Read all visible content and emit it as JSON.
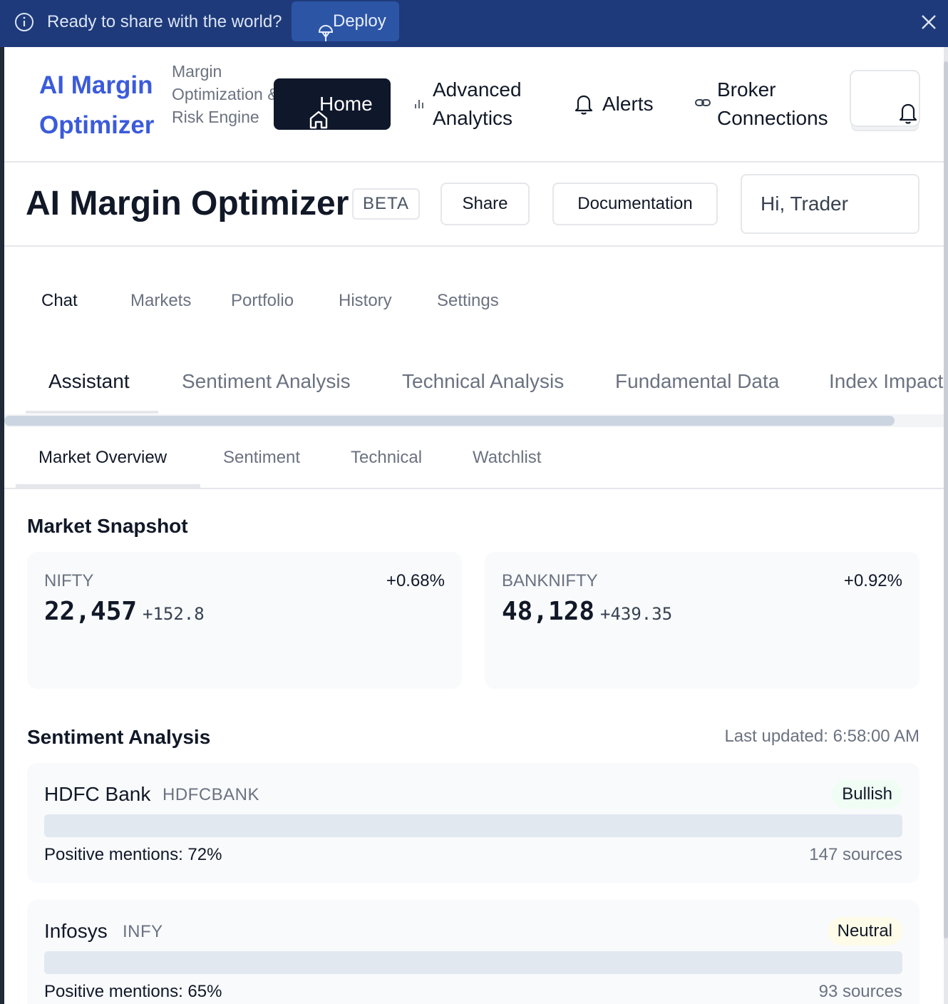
{
  "banner": {
    "message": "Ready to share with the world?",
    "deploy_label": "Deploy"
  },
  "header": {
    "logo_title": "AI Margin Optimizer",
    "logo_subtitle": "Margin Optimization & Risk Engine",
    "nav": {
      "home": "Home",
      "analytics": "Advanced Analytics",
      "alerts": "Alerts",
      "broker": "Broker Connections"
    }
  },
  "title_row": {
    "title": "AI Margin Optimizer",
    "badge": "BETA",
    "share": "Share",
    "docs": "Documentation",
    "greeting": "Hi, Trader"
  },
  "primary_tabs": [
    "Chat",
    "Markets",
    "Portfolio",
    "History",
    "Settings"
  ],
  "secondary_tabs": [
    "Assistant",
    "Sentiment Analysis",
    "Technical Analysis",
    "Fundamental Data",
    "Index Impact"
  ],
  "tertiary_tabs": [
    "Market Overview",
    "Sentiment",
    "Technical",
    "Watchlist"
  ],
  "market_snapshot": {
    "title": "Market Snapshot",
    "indices": [
      {
        "name": "NIFTY",
        "value": "22,457",
        "change": "+152.8",
        "pct": "+0.68%"
      },
      {
        "name": "BANKNIFTY",
        "value": "48,128",
        "change": "+439.35",
        "pct": "+0.92%"
      }
    ]
  },
  "sentiment": {
    "title": "Sentiment Analysis",
    "last_updated": "Last updated: 6:58:00 AM",
    "stocks": [
      {
        "name": "HDFC Bank",
        "symbol": "HDFCBANK",
        "label": "Bullish",
        "positive_pct": 72,
        "mentions": "Positive mentions: 72%",
        "sources": "147 sources"
      },
      {
        "name": "Infosys",
        "symbol": "INFY",
        "label": "Neutral",
        "positive_pct": 65,
        "mentions": "Positive mentions: 65%",
        "sources": "93 sources"
      }
    ]
  },
  "colors": {
    "banner_bg": "#1e3a7a",
    "logo_blue": "#3b5bdb",
    "home_bg": "#0f172a",
    "bullish_bg": "#f0fdf4",
    "neutral_bg": "#fefce8"
  },
  "icons": {
    "info": "info-icon",
    "deploy": "rocket-icon",
    "close": "close-icon",
    "home": "home-icon",
    "analytics": "bar-chart-icon",
    "alerts": "bell-icon",
    "broker": "link-icon",
    "notifications": "bell-icon"
  }
}
